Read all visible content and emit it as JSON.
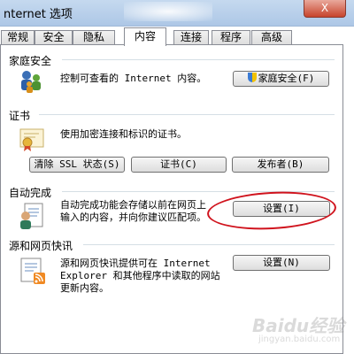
{
  "window": {
    "title": "nternet 选项",
    "close_label": "X"
  },
  "tabs": [
    {
      "label": "常规"
    },
    {
      "label": "安全"
    },
    {
      "label": "隐私"
    },
    {
      "label": "内容",
      "active": true
    },
    {
      "label": "连接"
    },
    {
      "label": "程序"
    },
    {
      "label": "高级"
    }
  ],
  "family_safety": {
    "title": "家庭安全",
    "description": "控制可查看的 Internet 内容。",
    "button": "家庭安全(F)"
  },
  "certificates": {
    "title": "证书",
    "description": "使用加密连接和标识的证书。",
    "clear_ssl_button": "清除 SSL 状态(S)",
    "certificates_button": "证书(C)",
    "publishers_button": "发布者(B)"
  },
  "autocomplete": {
    "title": "自动完成",
    "description_line1": "自动完成功能会存储以前在网页上",
    "description_line2": "输入的内容，并向你建议匹配项。",
    "button": "设置(I)"
  },
  "feeds": {
    "title": "源和网页快讯",
    "description_line1": "源和网页快讯提供可在 Internet",
    "description_line2": "Explorer 和其他程序中读取的网站",
    "description_line3": "更新内容。",
    "button": "设置(N)"
  },
  "annotation_color": "#d0131d",
  "watermark": {
    "brand": "Baidu经验",
    "sub": "jingyan.baidu.com"
  }
}
